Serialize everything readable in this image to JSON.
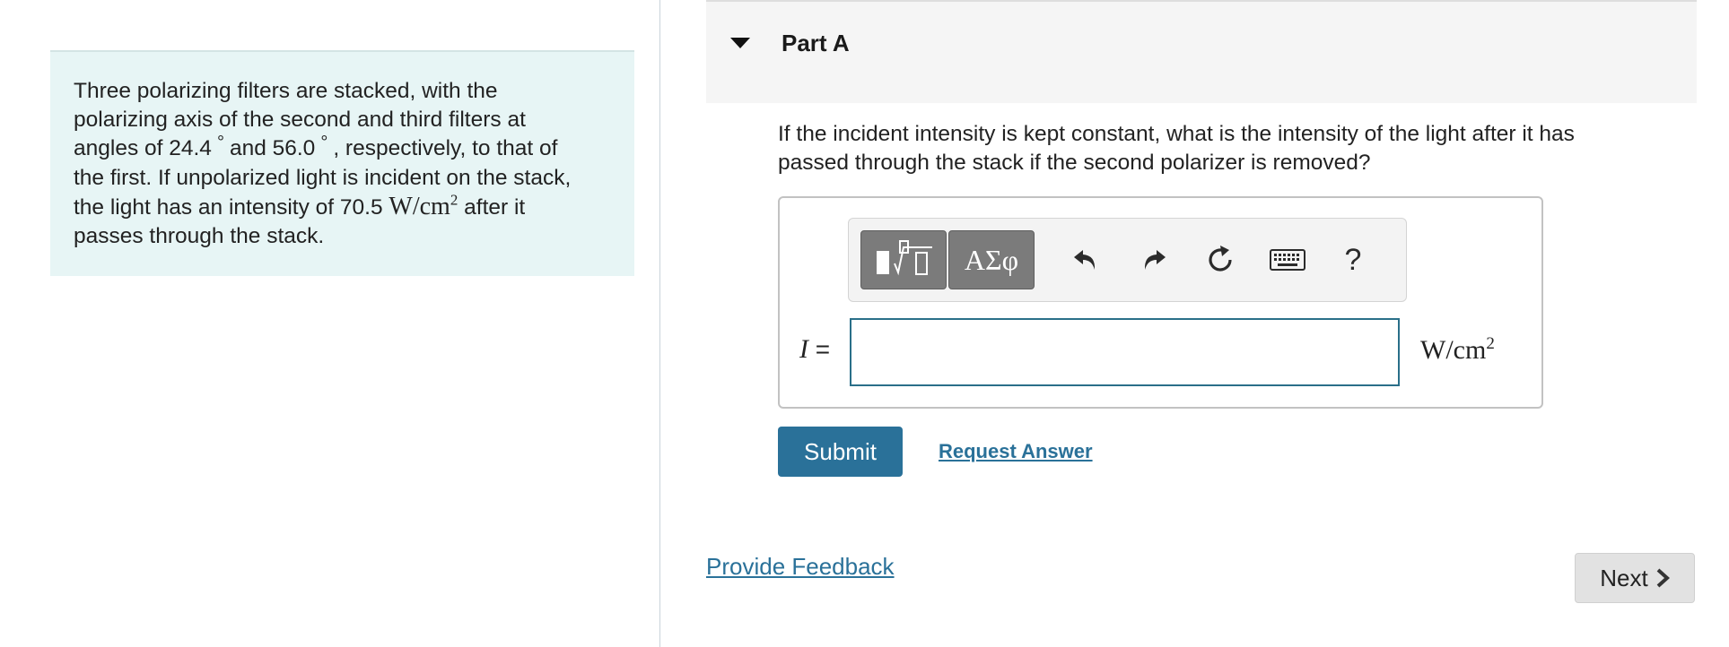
{
  "problem": {
    "line1": "Three polarizing filters are stacked, with the",
    "line2": "polarizing axis of the second and third filters at",
    "line3_a": "angles of 24.4",
    "line3_deg1": "°",
    "line3_b": "and 56.0",
    "line3_deg2": "°",
    "line3_c": ", respectively, to that of",
    "line4": "the first. If unpolarized light is incident on the stack,",
    "line5_a": "the light has an intensity of 70.5",
    "line5_unit": "W/cm",
    "line5_exp": "2",
    "line5_b": "after it",
    "line6": "passes through the stack."
  },
  "part": {
    "title": "Part A"
  },
  "question": {
    "line1": "If the incident intensity is kept constant, what is the intensity of the light after it has",
    "line2": "passed through the stack if the second polarizer is removed?"
  },
  "toolbar": {
    "symbols_label": "ΑΣφ",
    "help_label": "?",
    "icons": [
      "templates-icon",
      "undo-icon",
      "redo-icon",
      "reset-icon",
      "keyboard-icon",
      "help-icon"
    ]
  },
  "answer": {
    "variable": "I",
    "equals": "=",
    "value": "",
    "unit": "W/cm",
    "unit_exp": "2"
  },
  "actions": {
    "submit_label": "Submit",
    "request_label": "Request Answer",
    "feedback_label": "Provide Feedback",
    "next_label": "Next"
  },
  "colors": {
    "accent": "#2a7199",
    "problem_bg": "#e7f5f5",
    "input_border": "#2a6f89"
  }
}
